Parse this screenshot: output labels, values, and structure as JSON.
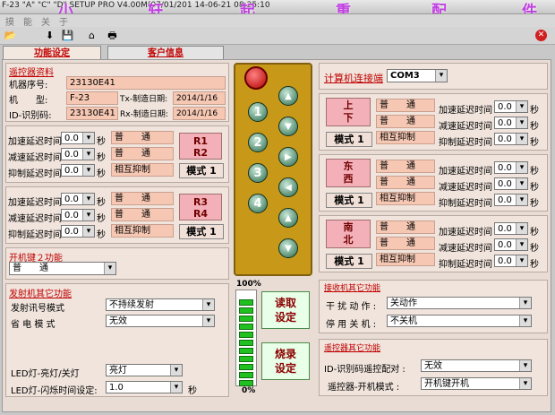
{
  "titlebar": {
    "text": "F-23 \"A\" \"C\" \"D\" SETUP PRO V4.00M(07/01/201 14-06-21 08:25:10",
    "watermark": [
      "小",
      "轩",
      "起",
      "重",
      "配",
      "件"
    ]
  },
  "menu": [
    "摸",
    "能",
    "关",
    "于"
  ],
  "tabs": {
    "func": "功能设定",
    "client": "客户信息"
  },
  "remote_info": {
    "section": "遥控器资料",
    "serial_label": "机器序号:",
    "serial": "23130E41",
    "model_label": "机　　型:",
    "model": "F-23",
    "id_label": "ID-识别码:",
    "id": "23130E41",
    "tx_label": "Tx-制造日期:",
    "tx_date": "2014/1/16",
    "rx_label": "Rx-制造日期:",
    "rx_date": "2014/1/16"
  },
  "delay_labels": {
    "accel": "加速延迟时间",
    "decel": "减速延迟时间",
    "inhibit": "抑制延迟时间",
    "sec": "秒"
  },
  "group_r12": {
    "accel": "0.0",
    "decel": "0.0",
    "inhibit": "0.0",
    "v1": "普　　通",
    "v2": "普　　通",
    "v3": "相互抑制",
    "btn": "R1\nR2",
    "btn1": "R1",
    "btn2": "R2",
    "mode": "模式 1"
  },
  "group_r34": {
    "accel": "0.0",
    "decel": "0.0",
    "inhibit": "0.0",
    "v1": "普　　通",
    "v2": "普　　通",
    "v3": "相互抑制",
    "btn1": "R3",
    "btn2": "R4",
    "mode": "模式 1"
  },
  "key2": {
    "section": "开机键２功能",
    "value": "普　　通"
  },
  "transmitter": {
    "section": "发射机其它功能",
    "signal_label": "发射讯号模式",
    "signal_value": "不持续发射",
    "power_label": "省 电 模 式",
    "power_value": "无效",
    "led_label": "LED灯-亮灯/关灯",
    "led_value": "亮灯",
    "blink_label": "LED灯-闪烁时间设定:",
    "blink_value": "1.0",
    "sec": "秒"
  },
  "meter": {
    "top": "100%",
    "bottom": "0%",
    "level": 1.0
  },
  "actions": {
    "read": "读取\n设定",
    "read1": "读取",
    "read2": "设定",
    "write1": "烧录",
    "write2": "设定"
  },
  "remote_buttons": [
    "1",
    "2",
    "3",
    "4"
  ],
  "computer": {
    "label": "计算机连接端",
    "port": "COM3"
  },
  "axes": [
    {
      "name1": "上",
      "name2": "下",
      "v1": "普　　通",
      "v2": "普　　通",
      "v3": "相互抑制",
      "mode": "模式 1",
      "accel": "0.0",
      "decel": "0.0",
      "inhibit": "0.0"
    },
    {
      "name1": "东",
      "name2": "西",
      "v1": "普　　通",
      "v2": "普　　通",
      "v3": "相互抑制",
      "mode": "模式 1",
      "accel": "0.0",
      "decel": "0.0",
      "inhibit": "0.0"
    },
    {
      "name1": "南",
      "name2": "北",
      "v1": "普　　通",
      "v2": "普　　通",
      "v3": "相互抑制",
      "mode": "模式 1",
      "accel": "0.0",
      "decel": "0.0",
      "inhibit": "0.0"
    }
  ],
  "receiver": {
    "section": "接收机其它功能",
    "interference_label": "干 扰 动 作 :",
    "interference_value": "关动作",
    "stop_label": "停 用 关 机 :",
    "stop_value": "不关机"
  },
  "remote_other": {
    "section": "遥控器其它功能",
    "pair_label": "ID-识别码遥控配对 :",
    "pair_value": "无效",
    "startup_label": "遥控器-开机模式 :",
    "startup_value": "开机键开机"
  },
  "colors": {
    "accent": "#c00000",
    "panel": "#f0e4dc",
    "field": "#f6c8b4"
  }
}
